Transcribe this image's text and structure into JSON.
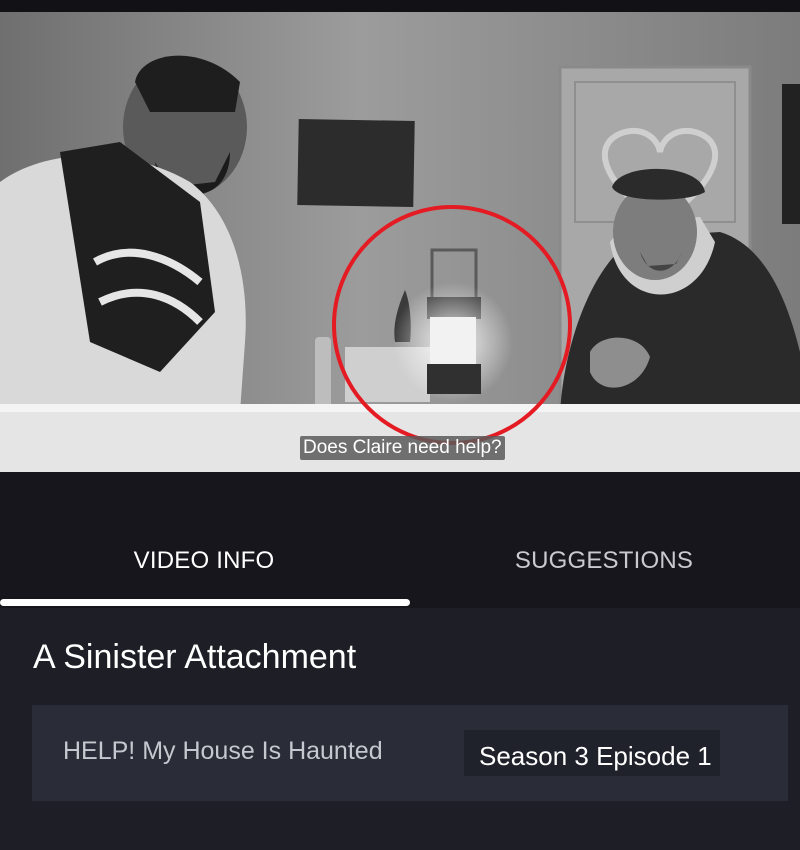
{
  "video": {
    "subtitle": "Does Claire need help?",
    "highlight_color": "#e41b23"
  },
  "tabs": [
    {
      "label": "VIDEO INFO",
      "selected": true
    },
    {
      "label": "SUGGESTIONS",
      "selected": false
    }
  ],
  "info": {
    "title": "A Sinister Attachment",
    "series": "HELP! My House Is Haunted",
    "episode": "Season 3 Episode 1"
  },
  "colors": {
    "background": "#16161c",
    "panel": "#1e1f26",
    "meta_box": "#2a2d38",
    "tab_indicator": "#ffffff"
  }
}
